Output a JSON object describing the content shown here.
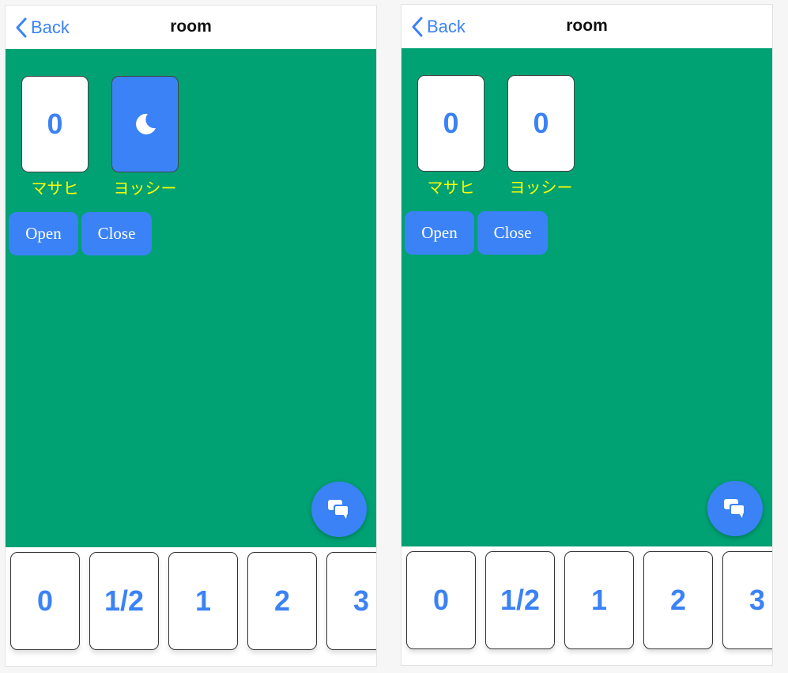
{
  "colors": {
    "accent": "#3b82f6",
    "table_green": "#00a173",
    "player_name": "#ffff00"
  },
  "screens": [
    {
      "header": {
        "back_label": "Back",
        "title": "room"
      },
      "players": [
        {
          "name": "マサヒ",
          "card_value": "0",
          "card_state": "revealed"
        },
        {
          "name": "ヨッシー",
          "card_value": "",
          "card_state": "sleeping",
          "card_icon": "moon-icon"
        }
      ],
      "buttons": {
        "open_label": "Open",
        "close_label": "Close"
      },
      "chat_icon": "chat-bubbles-icon",
      "hand_cards": [
        "0",
        "1/2",
        "1",
        "2",
        "3"
      ]
    },
    {
      "header": {
        "back_label": "Back",
        "title": "room"
      },
      "players": [
        {
          "name": "マサヒ",
          "card_value": "0",
          "card_state": "revealed"
        },
        {
          "name": "ヨッシー",
          "card_value": "0",
          "card_state": "revealed"
        }
      ],
      "buttons": {
        "open_label": "Open",
        "close_label": "Close"
      },
      "chat_icon": "chat-bubbles-icon",
      "hand_cards": [
        "0",
        "1/2",
        "1",
        "2",
        "3"
      ]
    }
  ]
}
